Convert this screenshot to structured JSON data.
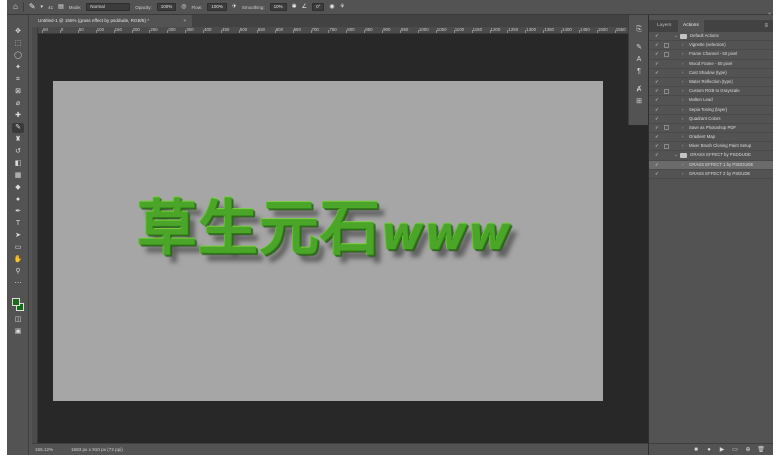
{
  "options_bar": {
    "mode_label": "Mode:",
    "mode_value": "Normal",
    "opacity_label": "Opacity:",
    "opacity_value": "100%",
    "flow_label": "Flow:",
    "flow_value": "100%",
    "smoothing_label": "Smoothing:",
    "smoothing_value": "10%",
    "angle_value": "0°",
    "brush_size": "41"
  },
  "document": {
    "tab_title": "Untitled-1 @ 155% (grass effect by psddude, RGB/8) *",
    "close_glyph": "×",
    "artwork_text_cjk": "草生元石",
    "artwork_text_latin": "www"
  },
  "ruler_labels": [
    "50",
    "0",
    "50",
    "100",
    "150",
    "200",
    "250",
    "300",
    "350",
    "400",
    "450",
    "500",
    "550",
    "600",
    "650",
    "700",
    "750",
    "800",
    "850",
    "900",
    "950",
    "1000",
    "1050",
    "1100",
    "1150",
    "1200",
    "1250",
    "1300",
    "1350",
    "1400",
    "1450",
    "1500",
    "1550",
    "1600"
  ],
  "status_bar": {
    "zoom": "155.12%",
    "doc_info": "1583 px x 910 px (72 ppi)"
  },
  "panels": {
    "tabs": [
      "Layers",
      "Actions"
    ],
    "active_tab": "Actions",
    "menu_glyph": "≡",
    "close_glyph": "«"
  },
  "actions": [
    {
      "label": "Default Actions",
      "level": 0,
      "folder": true,
      "open": true,
      "dialog": false,
      "selected": false
    },
    {
      "label": "Vignette (selection)",
      "level": 1,
      "folder": false,
      "open": false,
      "dialog": true,
      "selected": false
    },
    {
      "label": "Frame Channel - 50 pixel",
      "level": 1,
      "folder": false,
      "open": false,
      "dialog": true,
      "selected": false
    },
    {
      "label": "Wood Frame - 50 pixel",
      "level": 1,
      "folder": false,
      "open": false,
      "dialog": false,
      "selected": false
    },
    {
      "label": "Cast Shadow (type)",
      "level": 1,
      "folder": false,
      "open": false,
      "dialog": false,
      "selected": false
    },
    {
      "label": "Water Reflection (type)",
      "level": 1,
      "folder": false,
      "open": false,
      "dialog": false,
      "selected": false
    },
    {
      "label": "Custom RGB to Grayscale",
      "level": 1,
      "folder": false,
      "open": false,
      "dialog": true,
      "selected": false
    },
    {
      "label": "Molten Lead",
      "level": 1,
      "folder": false,
      "open": false,
      "dialog": false,
      "selected": false
    },
    {
      "label": "Sepia Toning (layer)",
      "level": 1,
      "folder": false,
      "open": false,
      "dialog": false,
      "selected": false
    },
    {
      "label": "Quadrant Colors",
      "level": 1,
      "folder": false,
      "open": false,
      "dialog": false,
      "selected": false
    },
    {
      "label": "Save as Photoshop PDF",
      "level": 1,
      "folder": false,
      "open": false,
      "dialog": true,
      "selected": false
    },
    {
      "label": "Gradient Map",
      "level": 1,
      "folder": false,
      "open": false,
      "dialog": false,
      "selected": false
    },
    {
      "label": "Mixer Brush Cloning Paint Setup",
      "level": 1,
      "folder": false,
      "open": false,
      "dialog": true,
      "selected": false
    },
    {
      "label": "GRASS EFFECT by PSDDUDE",
      "level": 0,
      "folder": true,
      "open": true,
      "dialog": false,
      "selected": false
    },
    {
      "label": "GRASS EFFECT 1 by PSDDUDE",
      "level": 1,
      "folder": false,
      "open": false,
      "dialog": false,
      "selected": true
    },
    {
      "label": "GRASS EFFECT 2 by PSDUDE",
      "level": 1,
      "folder": false,
      "open": false,
      "dialog": false,
      "selected": false
    }
  ],
  "checkmark_glyph": "✓",
  "icons": {
    "home": "home-icon",
    "brush": "brush-icon"
  },
  "colors": {
    "foreground": "#1b6b1b",
    "background": "#107010",
    "grass": "#4aa528"
  }
}
